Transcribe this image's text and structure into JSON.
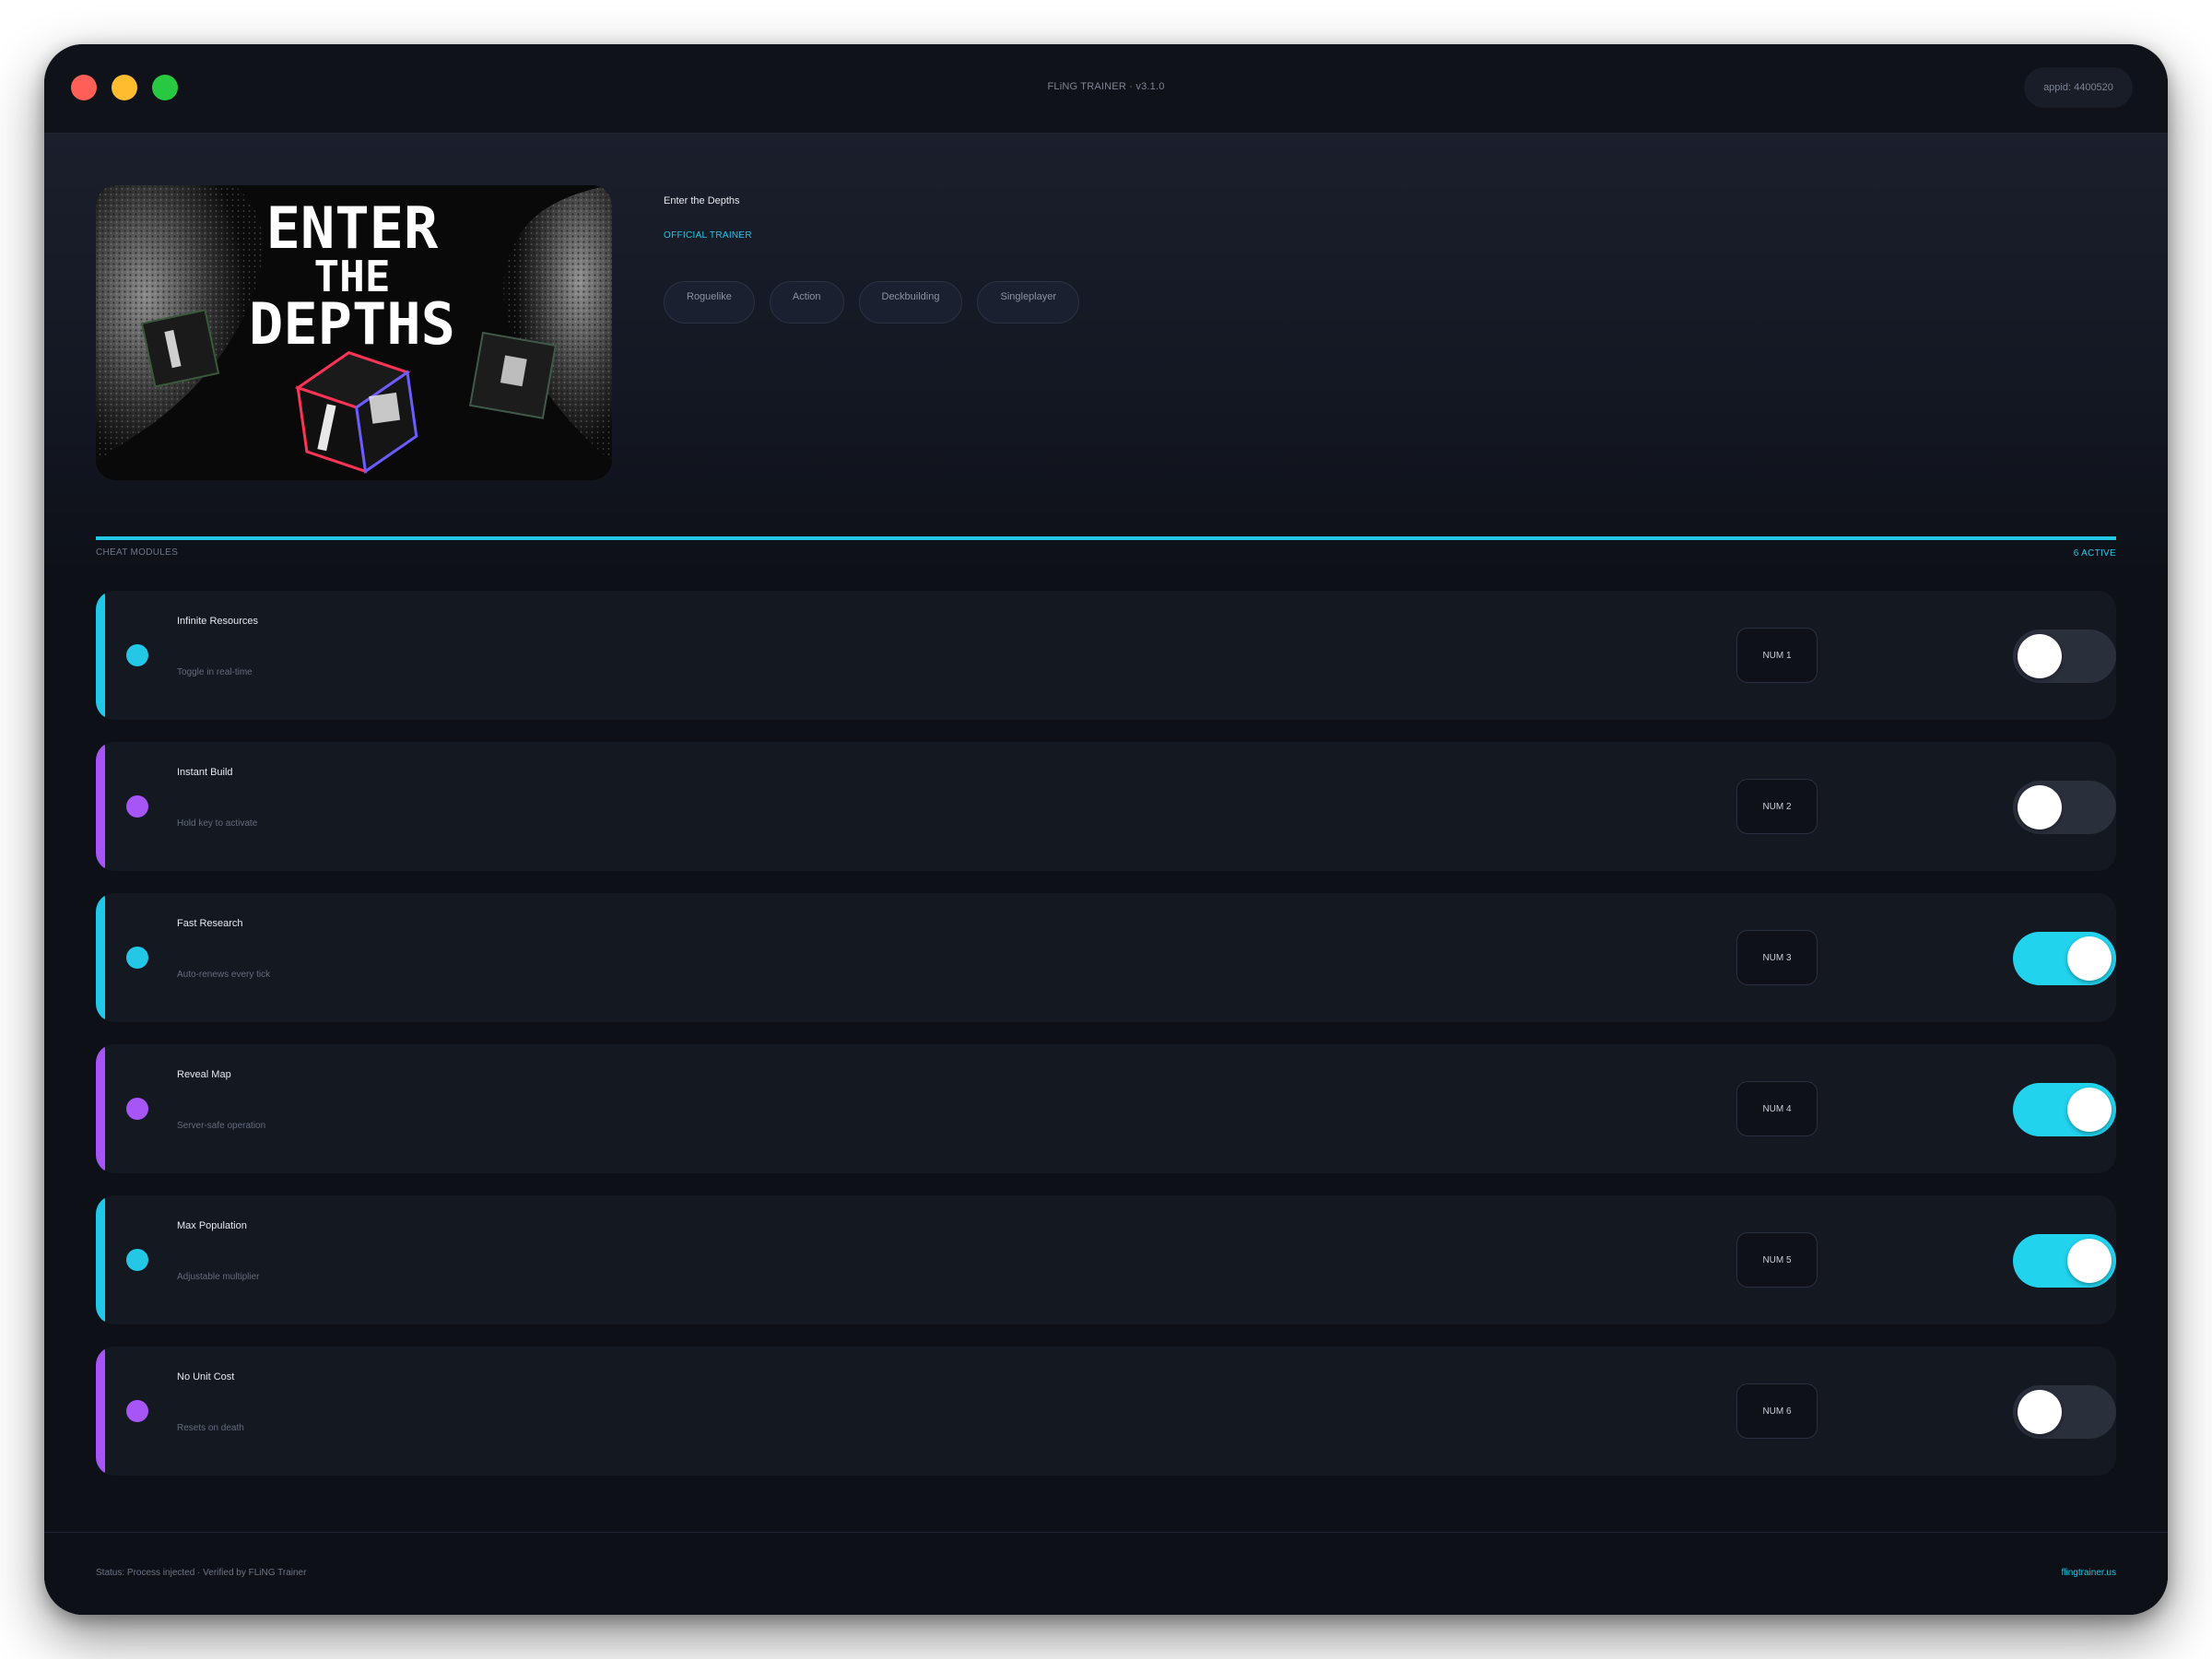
{
  "window": {
    "title": "FLiNG TRAINER · v3.1.0",
    "appid": "appid: 4400520"
  },
  "game": {
    "title": "Enter the Depths",
    "badge": "OFFICIAL TRAINER",
    "tags": [
      "Roguelike",
      "Action",
      "Deckbuilding",
      "Singleplayer"
    ],
    "cover_art_text": [
      "ENTER",
      "THE",
      "DEPTHS"
    ]
  },
  "section": {
    "label": "CHEAT MODULES",
    "active_count": "6 ACTIVE"
  },
  "modules": [
    {
      "name": "Infinite Resources",
      "subtitle": "Toggle in real-time",
      "key": "NUM 1",
      "enabled": false,
      "accent": "#22c8e6"
    },
    {
      "name": "Instant Build",
      "subtitle": "Hold key to activate",
      "key": "NUM 2",
      "enabled": false,
      "accent": "#a855f7"
    },
    {
      "name": "Fast Research",
      "subtitle": "Auto-renews every tick",
      "key": "NUM 3",
      "enabled": true,
      "accent": "#22c8e6"
    },
    {
      "name": "Reveal Map",
      "subtitle": "Server-safe operation",
      "key": "NUM 4",
      "enabled": true,
      "accent": "#a855f7"
    },
    {
      "name": "Max Population",
      "subtitle": "Adjustable multiplier",
      "key": "NUM 5",
      "enabled": true,
      "accent": "#22c8e6"
    },
    {
      "name": "No Unit Cost",
      "subtitle": "Resets on death",
      "key": "NUM 6",
      "enabled": false,
      "accent": "#a855f7"
    }
  ],
  "footer": {
    "status": "Status: Process injected · Verified by FLiNG Trainer",
    "link": "flingtrainer.us"
  },
  "colors": {
    "accent_cyan": "#22c8e6",
    "accent_purple": "#a855f7",
    "toggle_on": "#22d3ee",
    "background": "#0d1017"
  }
}
